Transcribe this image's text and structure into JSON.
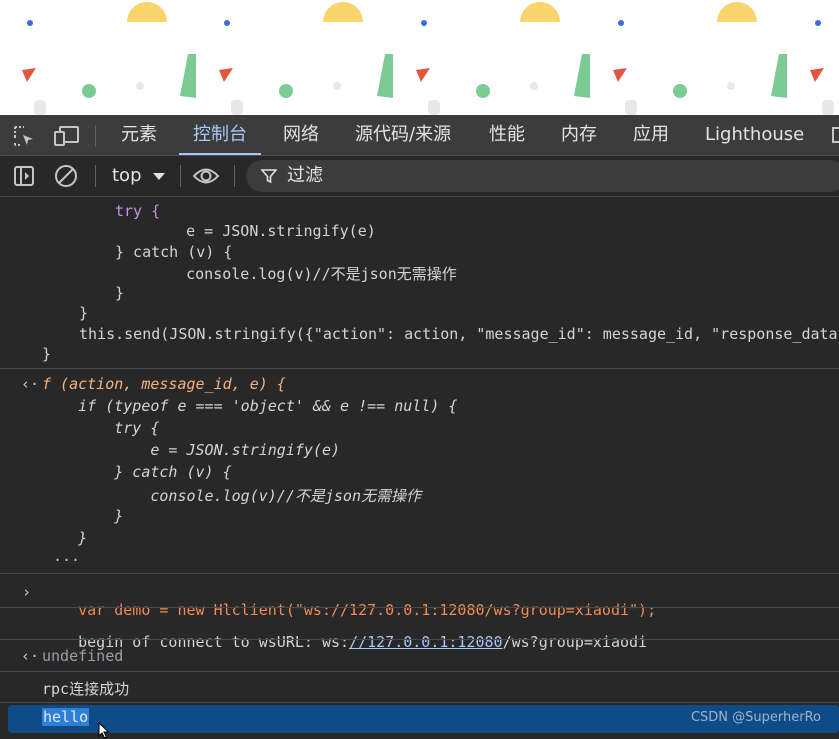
{
  "tabs": {
    "items": [
      "元素",
      "控制台",
      "网络",
      "源代码/来源",
      "性能",
      "内存",
      "应用",
      "Lighthouse"
    ],
    "active": "控制台"
  },
  "toolbar": {
    "context": "top",
    "filter_placeholder": "过滤"
  },
  "console": {
    "code_lines": [
      "try {",
      "    e = JSON.stringify(e)",
      "} catch (v) {",
      "    console.log(v)//不是json无需操作",
      "}",
      "}",
      "this.send(JSON.stringify({\"action\": action, \"message_id\": message_id, \"response_data\"",
      "}"
    ],
    "return_lines": [
      "f (action, message_id, e) {",
      "    if (typeof e === 'object' && e !== null) {",
      "        try {",
      "            e = JSON.stringify(e)",
      "        } catch (v) {",
      "            console.log(v)//不是json无需操作",
      "        }",
      "    }",
      "..."
    ],
    "input_line": "var demo = new Hlclient(\"ws://127.0.0.1:12080/ws?group=xiaodi\");",
    "log_prefix": "begin of connect to wsURL: ws:",
    "log_link": "//127.0.0.1:12080",
    "log_suffix": "/ws?group=xiaodi",
    "undefined": "undefined",
    "rpc_success": "rpc连接成功",
    "selected": "hello"
  },
  "watermark": "CSDN @SuperherRo",
  "colors": {
    "accent": "#a8c7fa",
    "selection": "#0f4b86",
    "string": "#f28b54",
    "keyword": "#c792ea"
  }
}
